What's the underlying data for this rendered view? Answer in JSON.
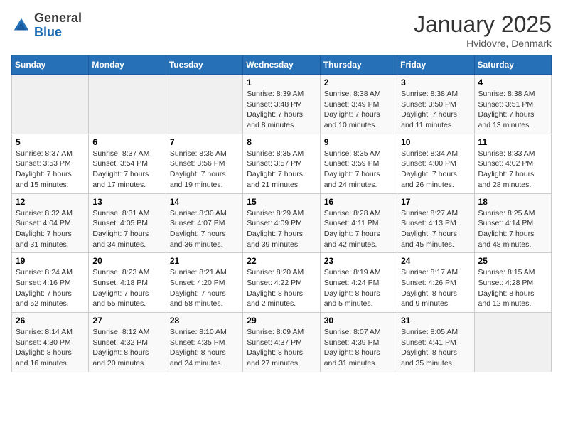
{
  "header": {
    "logo_general": "General",
    "logo_blue": "Blue",
    "month_year": "January 2025",
    "location": "Hvidovre, Denmark"
  },
  "calendar": {
    "weekdays": [
      "Sunday",
      "Monday",
      "Tuesday",
      "Wednesday",
      "Thursday",
      "Friday",
      "Saturday"
    ],
    "weeks": [
      [
        {
          "day": "",
          "info": ""
        },
        {
          "day": "",
          "info": ""
        },
        {
          "day": "",
          "info": ""
        },
        {
          "day": "1",
          "info": "Sunrise: 8:39 AM\nSunset: 3:48 PM\nDaylight: 7 hours\nand 8 minutes."
        },
        {
          "day": "2",
          "info": "Sunrise: 8:38 AM\nSunset: 3:49 PM\nDaylight: 7 hours\nand 10 minutes."
        },
        {
          "day": "3",
          "info": "Sunrise: 8:38 AM\nSunset: 3:50 PM\nDaylight: 7 hours\nand 11 minutes."
        },
        {
          "day": "4",
          "info": "Sunrise: 8:38 AM\nSunset: 3:51 PM\nDaylight: 7 hours\nand 13 minutes."
        }
      ],
      [
        {
          "day": "5",
          "info": "Sunrise: 8:37 AM\nSunset: 3:53 PM\nDaylight: 7 hours\nand 15 minutes."
        },
        {
          "day": "6",
          "info": "Sunrise: 8:37 AM\nSunset: 3:54 PM\nDaylight: 7 hours\nand 17 minutes."
        },
        {
          "day": "7",
          "info": "Sunrise: 8:36 AM\nSunset: 3:56 PM\nDaylight: 7 hours\nand 19 minutes."
        },
        {
          "day": "8",
          "info": "Sunrise: 8:35 AM\nSunset: 3:57 PM\nDaylight: 7 hours\nand 21 minutes."
        },
        {
          "day": "9",
          "info": "Sunrise: 8:35 AM\nSunset: 3:59 PM\nDaylight: 7 hours\nand 24 minutes."
        },
        {
          "day": "10",
          "info": "Sunrise: 8:34 AM\nSunset: 4:00 PM\nDaylight: 7 hours\nand 26 minutes."
        },
        {
          "day": "11",
          "info": "Sunrise: 8:33 AM\nSunset: 4:02 PM\nDaylight: 7 hours\nand 28 minutes."
        }
      ],
      [
        {
          "day": "12",
          "info": "Sunrise: 8:32 AM\nSunset: 4:04 PM\nDaylight: 7 hours\nand 31 minutes."
        },
        {
          "day": "13",
          "info": "Sunrise: 8:31 AM\nSunset: 4:05 PM\nDaylight: 7 hours\nand 34 minutes."
        },
        {
          "day": "14",
          "info": "Sunrise: 8:30 AM\nSunset: 4:07 PM\nDaylight: 7 hours\nand 36 minutes."
        },
        {
          "day": "15",
          "info": "Sunrise: 8:29 AM\nSunset: 4:09 PM\nDaylight: 7 hours\nand 39 minutes."
        },
        {
          "day": "16",
          "info": "Sunrise: 8:28 AM\nSunset: 4:11 PM\nDaylight: 7 hours\nand 42 minutes."
        },
        {
          "day": "17",
          "info": "Sunrise: 8:27 AM\nSunset: 4:13 PM\nDaylight: 7 hours\nand 45 minutes."
        },
        {
          "day": "18",
          "info": "Sunrise: 8:25 AM\nSunset: 4:14 PM\nDaylight: 7 hours\nand 48 minutes."
        }
      ],
      [
        {
          "day": "19",
          "info": "Sunrise: 8:24 AM\nSunset: 4:16 PM\nDaylight: 7 hours\nand 52 minutes."
        },
        {
          "day": "20",
          "info": "Sunrise: 8:23 AM\nSunset: 4:18 PM\nDaylight: 7 hours\nand 55 minutes."
        },
        {
          "day": "21",
          "info": "Sunrise: 8:21 AM\nSunset: 4:20 PM\nDaylight: 7 hours\nand 58 minutes."
        },
        {
          "day": "22",
          "info": "Sunrise: 8:20 AM\nSunset: 4:22 PM\nDaylight: 8 hours\nand 2 minutes."
        },
        {
          "day": "23",
          "info": "Sunrise: 8:19 AM\nSunset: 4:24 PM\nDaylight: 8 hours\nand 5 minutes."
        },
        {
          "day": "24",
          "info": "Sunrise: 8:17 AM\nSunset: 4:26 PM\nDaylight: 8 hours\nand 9 minutes."
        },
        {
          "day": "25",
          "info": "Sunrise: 8:15 AM\nSunset: 4:28 PM\nDaylight: 8 hours\nand 12 minutes."
        }
      ],
      [
        {
          "day": "26",
          "info": "Sunrise: 8:14 AM\nSunset: 4:30 PM\nDaylight: 8 hours\nand 16 minutes."
        },
        {
          "day": "27",
          "info": "Sunrise: 8:12 AM\nSunset: 4:32 PM\nDaylight: 8 hours\nand 20 minutes."
        },
        {
          "day": "28",
          "info": "Sunrise: 8:10 AM\nSunset: 4:35 PM\nDaylight: 8 hours\nand 24 minutes."
        },
        {
          "day": "29",
          "info": "Sunrise: 8:09 AM\nSunset: 4:37 PM\nDaylight: 8 hours\nand 27 minutes."
        },
        {
          "day": "30",
          "info": "Sunrise: 8:07 AM\nSunset: 4:39 PM\nDaylight: 8 hours\nand 31 minutes."
        },
        {
          "day": "31",
          "info": "Sunrise: 8:05 AM\nSunset: 4:41 PM\nDaylight: 8 hours\nand 35 minutes."
        },
        {
          "day": "",
          "info": ""
        }
      ]
    ]
  }
}
